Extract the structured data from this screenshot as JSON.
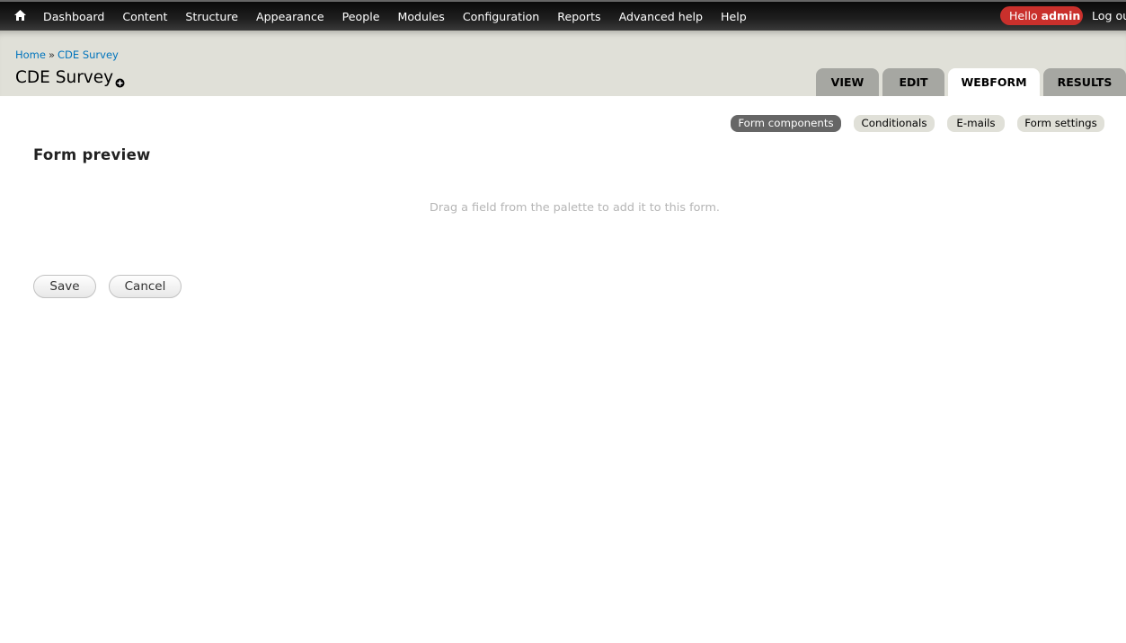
{
  "toolbar": {
    "home_icon": "home-icon",
    "menu": [
      "Dashboard",
      "Content",
      "Structure",
      "Appearance",
      "People",
      "Modules",
      "Configuration",
      "Reports",
      "Advanced help",
      "Help"
    ],
    "hello_prefix": "Hello ",
    "hello_user": "admin",
    "logout_label": "Log out",
    "accent_color": "#c9302c"
  },
  "header": {
    "breadcrumb": [
      "Home",
      "CDE Survey"
    ],
    "breadcrumb_separator": "»",
    "title": "CDE Survey",
    "shortcut_icon": "add-shortcut-icon",
    "tabs": [
      "VIEW",
      "EDIT",
      "WEBFORM",
      "RESULTS"
    ],
    "active_tab": "WEBFORM"
  },
  "subtabs": {
    "items": [
      "Form components",
      "Conditionals",
      "E-mails",
      "Form settings"
    ],
    "active": "Form components"
  },
  "main": {
    "preview_title": "Form preview",
    "empty_message": "Drag a field from the palette to add it to this form.",
    "save_label": "Save",
    "cancel_label": "Cancel"
  }
}
